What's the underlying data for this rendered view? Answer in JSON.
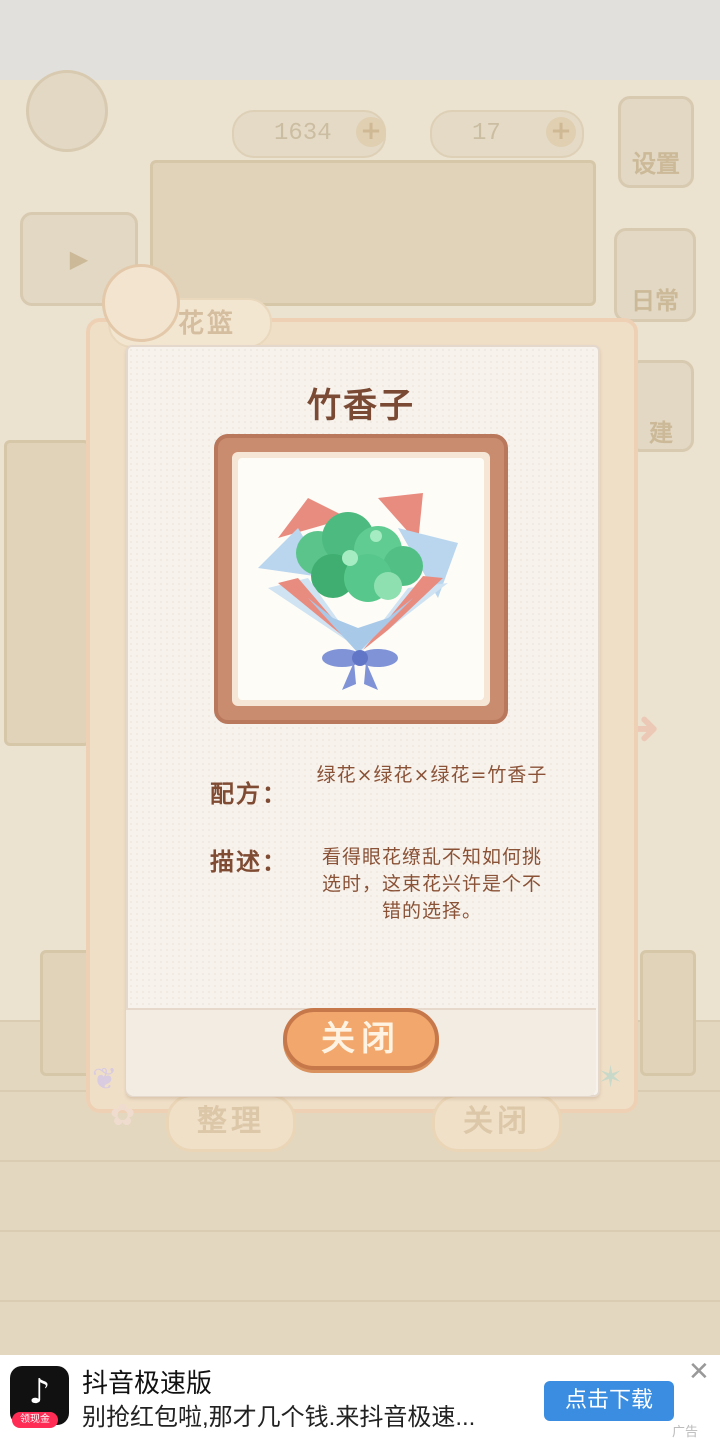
{
  "hud": {
    "currency_1": "1634",
    "currency_2": "17",
    "settings_label": "设置",
    "daily_label": "日常",
    "build_label": "建"
  },
  "dialog": {
    "tab_label": "花篮",
    "organize_label": "整理",
    "close_label_bottom": "关闭"
  },
  "card": {
    "title": "竹香子",
    "image_icon": "green-bouquet",
    "recipe_label": "配方：",
    "recipe_text": "绿花×绿花×绿花=竹香子",
    "desc_label": "描述：",
    "desc_text": "看得眼花缭乱不知如何挑选时，这束花兴许是个不错的选择。",
    "close_label": "关闭"
  },
  "ad": {
    "app_name": "抖音极速版",
    "desc": "别抢红包啦,那才几个钱.来抖音极速...",
    "cta": "点击下载",
    "badge": "领现金",
    "tag": "广告",
    "close_icon": "close-icon"
  },
  "colors": {
    "accent": "#f2a86c",
    "title": "#7a4a34",
    "ad_button": "#3a8de0"
  }
}
